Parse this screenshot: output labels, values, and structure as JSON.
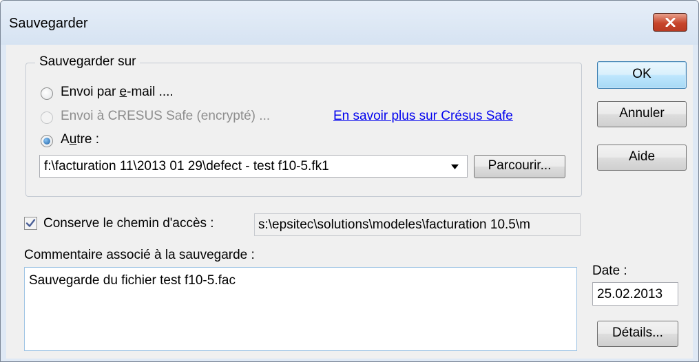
{
  "window": {
    "title": "Sauvegarder"
  },
  "group": {
    "legend": "Sauvegarder sur",
    "options": {
      "email": {
        "label_pre": "Envoi par ",
        "label_accel": "e",
        "label_post": "-mail ....",
        "selected": false,
        "enabled": true
      },
      "cresus_safe": {
        "label": "Envoi à CRESUS Safe (encrypté) ...",
        "selected": false,
        "enabled": false
      },
      "other": {
        "label_pre": "A",
        "label_accel": "u",
        "label_post": "tre :",
        "selected": true,
        "enabled": true
      }
    },
    "learn_more_link": "En savoir plus sur Crésus Safe",
    "path_combo_value": "f:\\facturation 11\\2013 01 29\\defect - test f10-5.fk1",
    "browse_button": "Parcourir..."
  },
  "keep_path": {
    "checked": true,
    "label": "Conserve le chemin d'accès :",
    "value": "s:\\epsitec\\solutions\\modeles\\facturation 10.5\\m"
  },
  "comment": {
    "label": "Commentaire associé à la sauvegarde :",
    "value": "Sauvegarde du fichier test f10-5.fac"
  },
  "date": {
    "label": "Date :",
    "value": "25.02.2013"
  },
  "buttons": {
    "ok": "OK",
    "cancel": "Annuler",
    "help": "Aide",
    "details": "Détails..."
  },
  "icons": {
    "close": "close-icon",
    "dropdown": "chevron-down-icon",
    "checkmark": "checkmark-icon"
  },
  "colors": {
    "title_bar": "#dfe9f5",
    "client_bg": "#f0f0f0",
    "close_button": "#c7452b",
    "link": "#0000ee",
    "default_button_border": "#3c7fb1"
  }
}
